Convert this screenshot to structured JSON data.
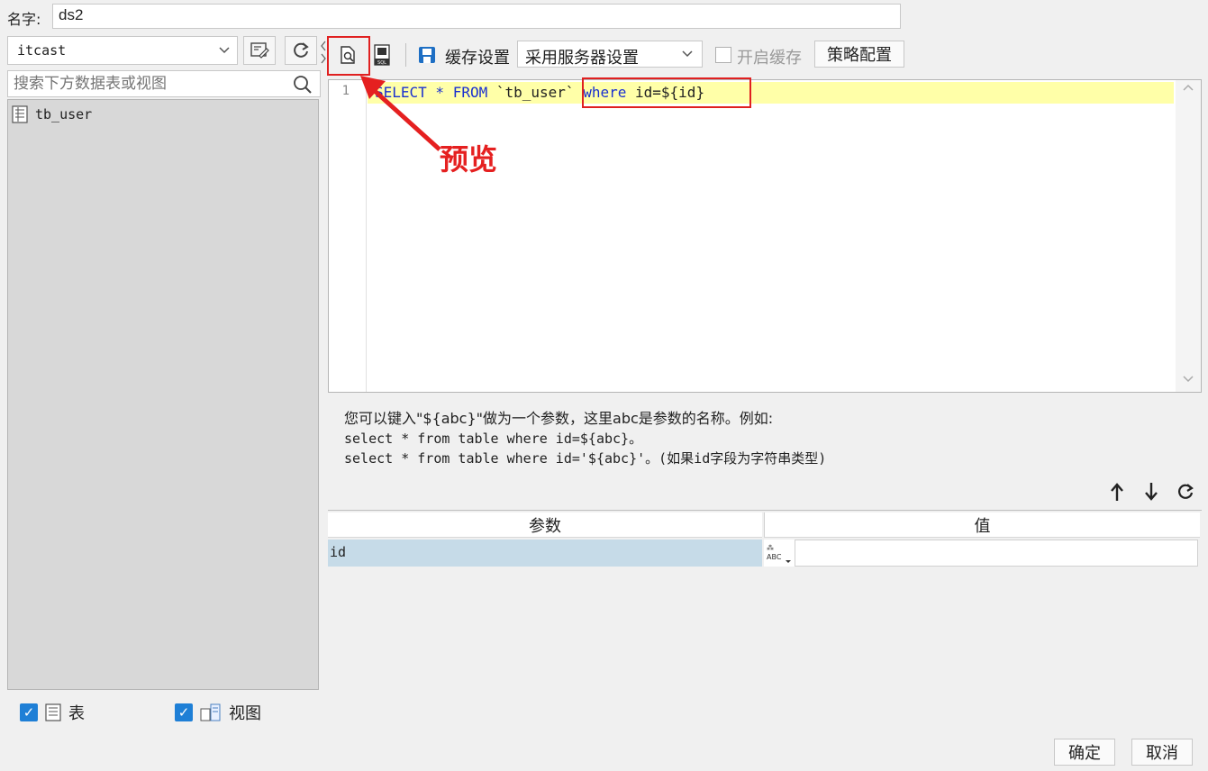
{
  "name_row": {
    "label": "名字:",
    "value": "ds2"
  },
  "left": {
    "db_select": "itcast",
    "search_placeholder": "搜索下方数据表或视图",
    "tree_items": [
      "tb_user"
    ],
    "filters": {
      "tables_label": "表",
      "views_label": "视图",
      "tables_checked": true,
      "views_checked": true
    }
  },
  "toolbar": {
    "cache_settings_label": "缓存设置",
    "cache_select_value": "采用服务器设置",
    "enable_cache_label": "开启缓存",
    "strategy_button": "策略配置"
  },
  "editor": {
    "line_number": "1",
    "sql_kw1": "SELECT",
    "sql_star": " * ",
    "sql_kw2": "FROM",
    "sql_table": " `tb_user` ",
    "sql_kw3": "where",
    "sql_rest": " id=${id}"
  },
  "hint": {
    "line1": "您可以键入\"${abc}\"做为一个参数，这里abc是参数的名称。例如:",
    "line2": "select * from table where id=${abc}。",
    "line3": "select * from table where id='${abc}'。(如果id字段为字符串类型)"
  },
  "params": {
    "header_param": "参数",
    "header_value": "值",
    "rows": [
      {
        "name": "id",
        "value": ""
      }
    ],
    "type_icon_text": "ABC"
  },
  "buttons": {
    "ok": "确定",
    "cancel": "取消"
  },
  "annotation": {
    "text": "预览",
    "color": "#e52020"
  }
}
